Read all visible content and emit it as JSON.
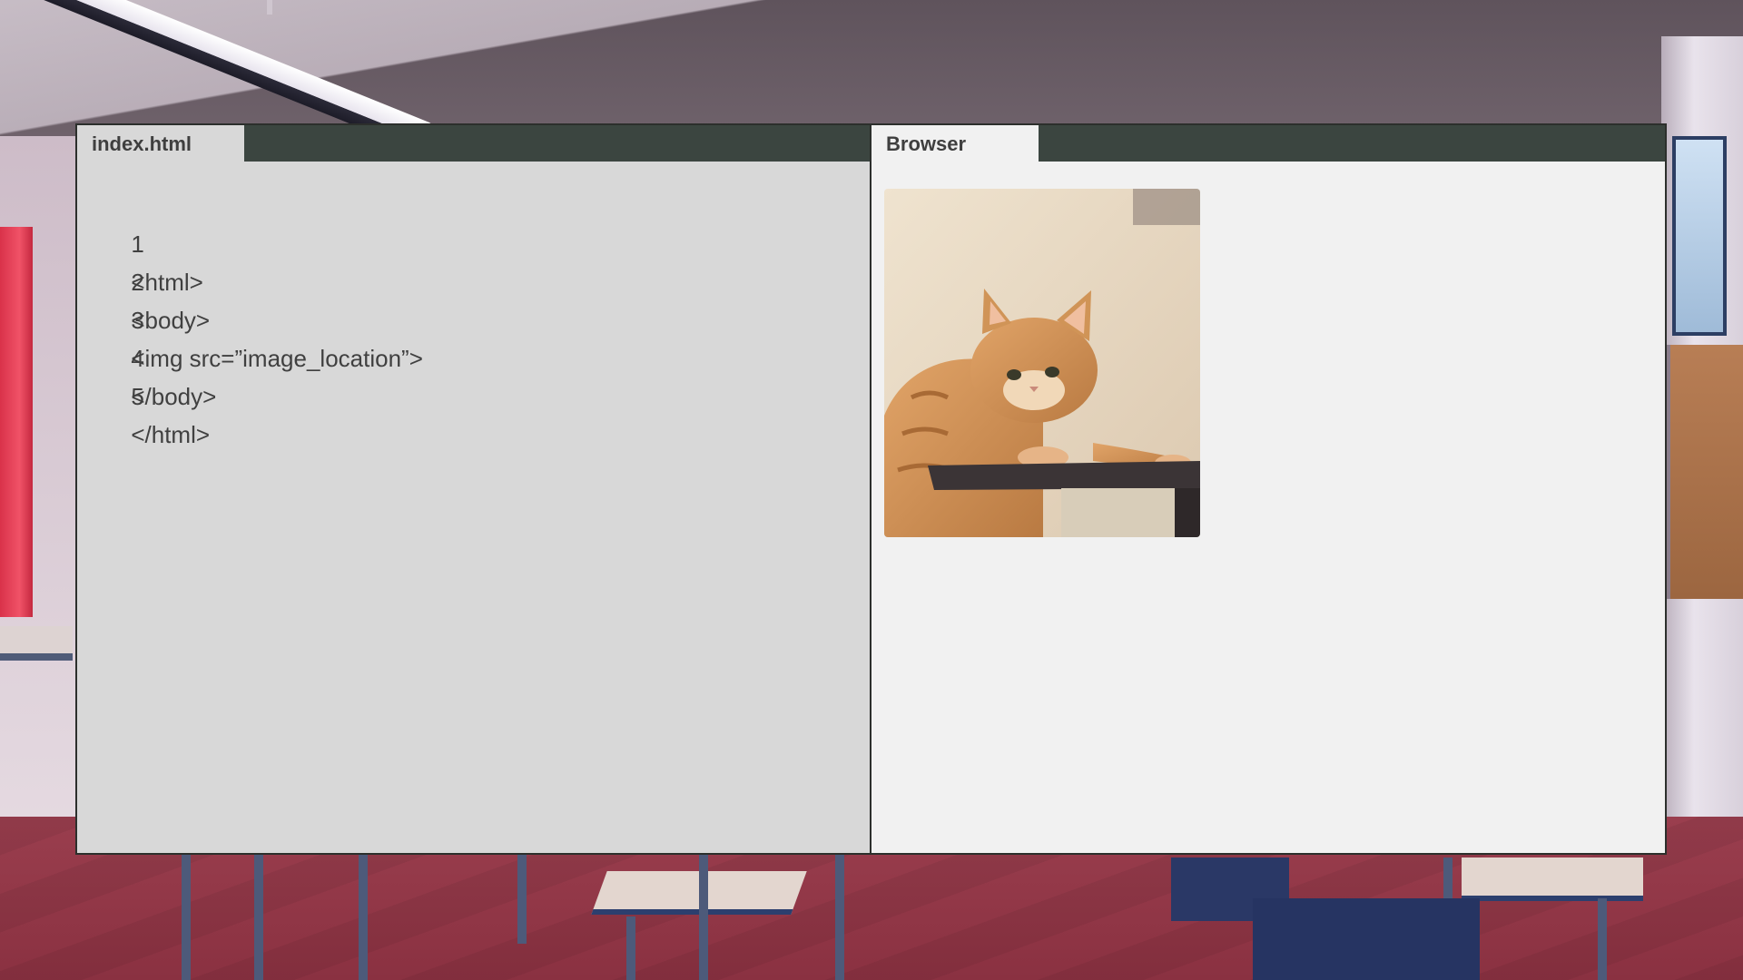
{
  "editor": {
    "tab_label": "index.html",
    "lines": [
      {
        "number": "1",
        "code": "<html>"
      },
      {
        "number": "2",
        "code": "<body>"
      },
      {
        "number": "3",
        "code": "<img src=”image_location”>"
      },
      {
        "number": "4",
        "code": "</body>"
      },
      {
        "number": "5",
        "code": "</html>"
      }
    ]
  },
  "browser": {
    "tab_label": "Browser",
    "content_image": "orange-tabby-cat-photo"
  },
  "colors": {
    "tab_bar": "#3b4540",
    "editor_bg": "#d8d8d8",
    "browser_bg": "#f1f1f1",
    "code_text": "#404040"
  }
}
